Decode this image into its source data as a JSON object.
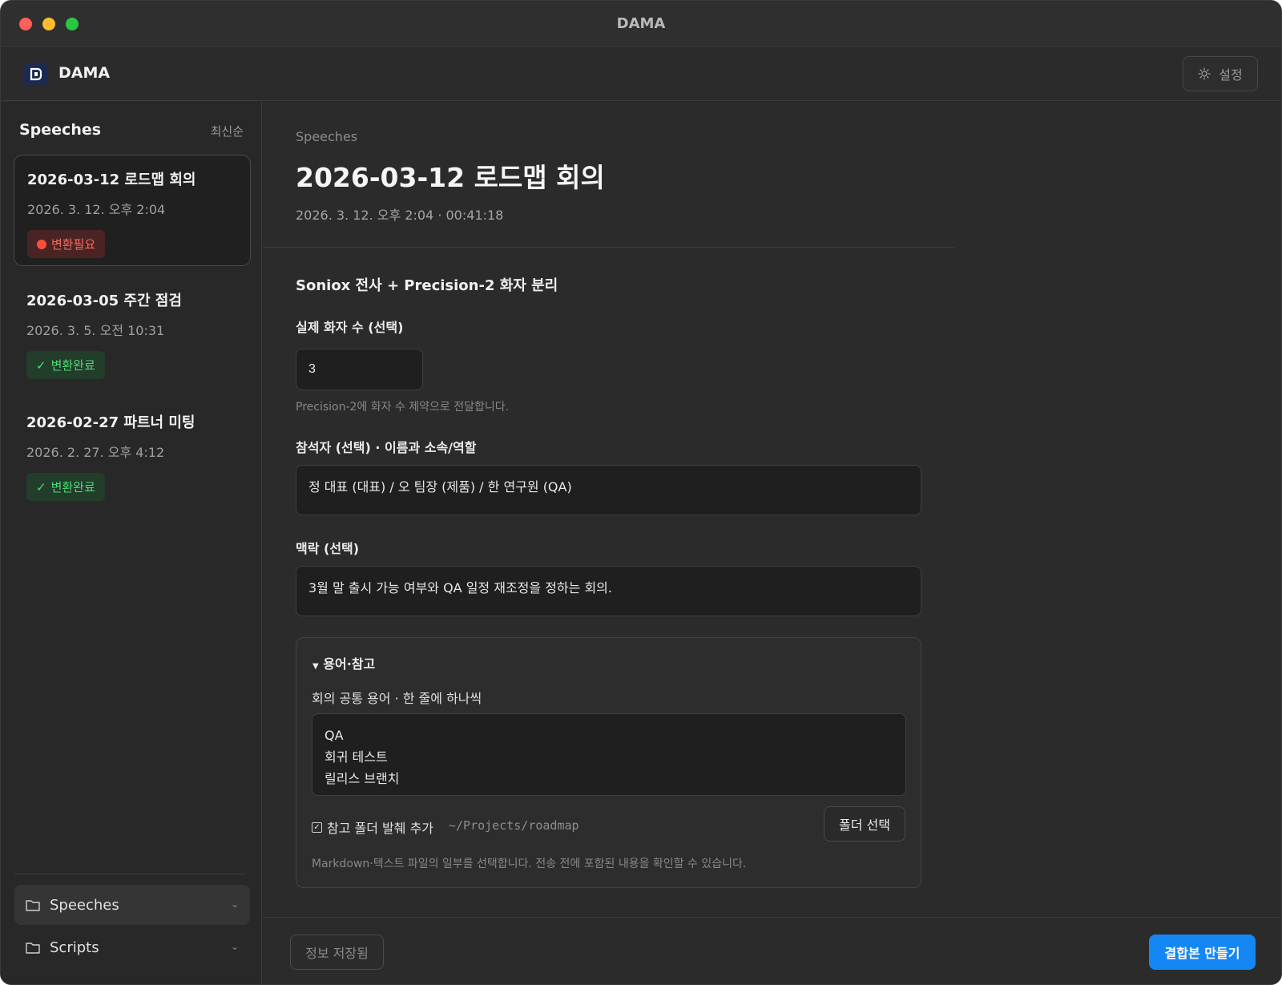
{
  "window": {
    "title": "DAMA"
  },
  "header": {
    "app_name": "DAMA",
    "settings_label": "설정"
  },
  "sidebar": {
    "heading": "Speeches",
    "sort_label": "최신순",
    "speeches": [
      {
        "title": "2026-03-12 로드맵 회의",
        "date": "2026. 3. 12. 오후 2:04",
        "status": "변환필요",
        "status_type": "needs-conversion"
      },
      {
        "title": "2026-03-05 주간 점검",
        "date": "2026. 3. 5. 오전 10:31",
        "status": "변환완료",
        "status_type": "converted"
      },
      {
        "title": "2026-02-27 파트너 미팅",
        "date": "2026. 2. 27. 오후 4:12",
        "status": "변환완료",
        "status_type": "converted"
      }
    ],
    "nav": [
      {
        "label": "Speeches",
        "icon": "folder-icon",
        "active": true
      },
      {
        "label": "Scripts",
        "icon": "folder-icon",
        "active": false
      }
    ]
  },
  "main": {
    "breadcrumb": "Speeches",
    "title": "2026-03-12 로드맵 회의",
    "meta": "2026. 3. 12. 오후 2:04 · 00:41:18",
    "section_title": "Soniox 전사 + Precision-2 화자 분리",
    "speaker_count": {
      "label": "실제 화자 수 (선택)",
      "value": "3",
      "hint": "Precision-2에 화자 수 제약으로 전달합니다."
    },
    "attendees": {
      "label": "참석자 (선택) · 이름과 소속/역할",
      "value": "정 대표 (대표) / 오 팀장 (제품) / 한 연구원 (QA)"
    },
    "context": {
      "label": "맥락 (선택)",
      "value": "3월 말 출시 가능 여부와 QA 일정 재조정을 정하는 회의."
    },
    "reference": {
      "summary": "용어·참고",
      "terms_label": "회의 공통 용어 · 한 줄에 하나씩",
      "terms": [
        "QA",
        "회귀 테스트",
        "릴리스 브랜치"
      ],
      "folder_check_label": "참고 폴더 발췌 추가",
      "folder_checked": true,
      "folder_path": "~/Projects/roadmap",
      "folder_button": "폴더 선택",
      "hint": "Markdown·텍스트 파일의 일부를 선택합니다. 전송 전에 포함된 내용을 확인할 수 있습니다."
    }
  },
  "footer": {
    "saved_label": "정보 저장됨",
    "combine_label": "결합본 만들기"
  },
  "colors": {
    "accent": "#1487f5",
    "status_needs": "#ff6b5e",
    "status_done": "#4fdc7a"
  }
}
